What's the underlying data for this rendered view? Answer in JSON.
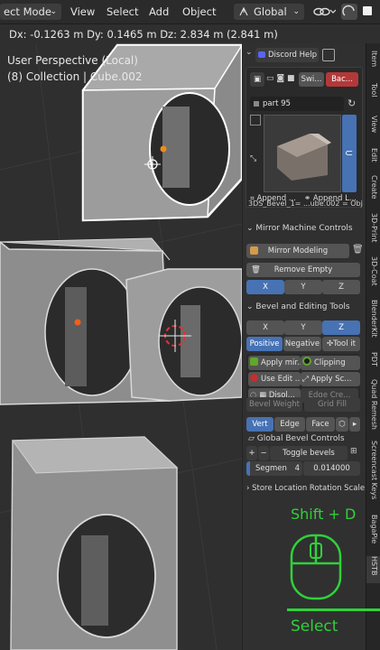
{
  "header": {
    "mode_label": "ect Mode",
    "menu": [
      "View",
      "Select",
      "Add",
      "Object"
    ],
    "transform_orientation": "Global"
  },
  "status_line": "Dx: -0.1263 m   Dy: 0.1465 m   Dz: 2.834 m (2.841 m)",
  "viewport": {
    "perspective": "User Perspective (Local)",
    "collection": "(8) Collection | Cube.002"
  },
  "npanel": {
    "top_bar": {
      "title": "Discord Help"
    },
    "asset_row": {
      "swi": "Swi...",
      "bac": "Bac..."
    },
    "asset_name": "part 95",
    "append_1": "Append ...",
    "append_2": "Append L...",
    "bevel_info": "3DS_Bevel_1= ...ube.002 = Obj",
    "mirror": {
      "title": "Mirror Machine Controls",
      "mirror_modeling": "Mirror Modeling",
      "remove_empty": "Remove Empty",
      "x": "X",
      "y": "Y",
      "z": "Z"
    },
    "bevel": {
      "title": "Bevel and Editing Tools",
      "x": "X",
      "y": "Y",
      "z": "Z",
      "positive": "Positive",
      "negative": "Negative",
      "tool_it": "Tool it",
      "apply_mir": "Apply mir...",
      "clipping": "Clipping",
      "use_edit": "Use Edit ...",
      "apply_sc": "Apply Sc...",
      "dissol": "Disol...",
      "edge_cre": "Edge Cre...",
      "bevel_weight": "Bevel Weight",
      "grid_fill": "Grid Fill",
      "vert": "Vert",
      "edge": "Edge",
      "face": "Face"
    },
    "global_bevel": {
      "title": "Global Bevel Controls",
      "toggle": "Toggle bevels",
      "segments_label": "Segmen",
      "segments_value": "4",
      "width_value": "0.014000"
    },
    "store_location": "Store Location Rotation Scale Bevel"
  },
  "side_tabs": [
    "Item",
    "Tool",
    "View",
    "Edit",
    "Create",
    "3D-Print",
    "3D-Coat",
    "BlenderKit",
    "PDT",
    "Quad Remesh",
    "Screencast Keys",
    "BagaPie",
    "HSTB"
  ],
  "overlay": {
    "shortcut": "Shift + D",
    "action": "Select"
  }
}
